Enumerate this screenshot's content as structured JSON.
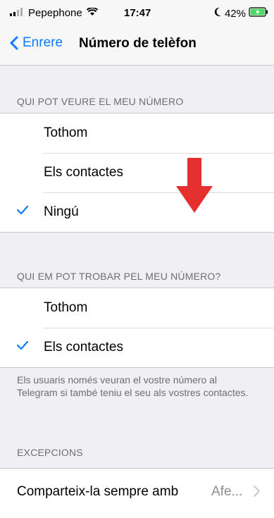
{
  "status": {
    "carrier": "Pepephone",
    "time": "17:47",
    "battery": "42%",
    "icons": [
      "signal-icon",
      "wifi-icon",
      "moon-icon",
      "battery-icon"
    ]
  },
  "nav": {
    "back_label": "Enrere",
    "title": "Número de telèfon"
  },
  "section1": {
    "header": "QUI POT VEURE EL MEU NÚMERO",
    "options": [
      {
        "label": "Tothom",
        "checked": false
      },
      {
        "label": "Els contactes",
        "checked": false
      },
      {
        "label": "Ningú",
        "checked": true
      }
    ]
  },
  "section2": {
    "header": "QUI EM POT TROBAR PEL MEU NÚMERO?",
    "options": [
      {
        "label": "Tothom",
        "checked": false
      },
      {
        "label": "Els contactes",
        "checked": true
      }
    ],
    "footer": "Els usuaris només veuran el vostre número al Telegram si també teniu el seu als vostres contactes."
  },
  "exceptions": {
    "header": "EXCEPCIONS",
    "row_label": "Comparteix-la sempre amb",
    "row_value": "Afe..."
  },
  "colors": {
    "accent": "#0a7aff",
    "annotation_arrow": "#e53030",
    "background": "#efeff4"
  }
}
